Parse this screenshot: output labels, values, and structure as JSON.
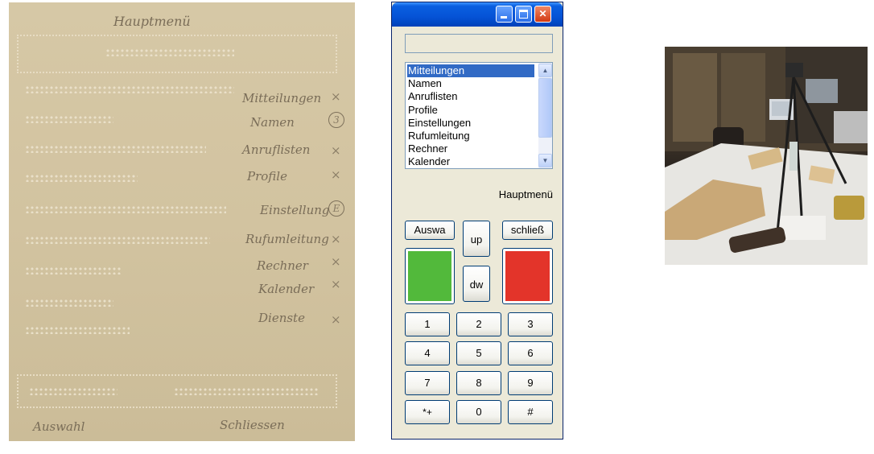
{
  "paper": {
    "title": "Hauptmenü",
    "menu_handwriting": [
      "Mitteilungen",
      "Namen",
      "Anruflisten",
      "Profile",
      "Einstellung",
      "Rufumleitung",
      "Rechner",
      "Kalender",
      "Dienste"
    ],
    "marks": [
      "×",
      "3",
      "×",
      "×",
      "E",
      "×",
      "×",
      "×",
      "×"
    ],
    "footer_left": "Auswahl",
    "footer_right": "Schliessen"
  },
  "app": {
    "display_value": "",
    "list_items": [
      "Mitteilungen",
      "Namen",
      "Anruflisten",
      "Profile",
      "Einstellungen",
      "Rufumleitung",
      "Rechner",
      "Kalender"
    ],
    "selected_index": 0,
    "status_label": "Hauptmenü",
    "buttons": {
      "select": "Auswa",
      "up": "up",
      "down": "dw",
      "close": "schließ"
    },
    "keypad": [
      "1",
      "2",
      "3",
      "4",
      "5",
      "6",
      "7",
      "8",
      "9",
      "*+",
      "0",
      "#"
    ],
    "colors": {
      "accept": "#52b93b",
      "reject": "#e3342a",
      "selection": "#316ac5"
    }
  }
}
